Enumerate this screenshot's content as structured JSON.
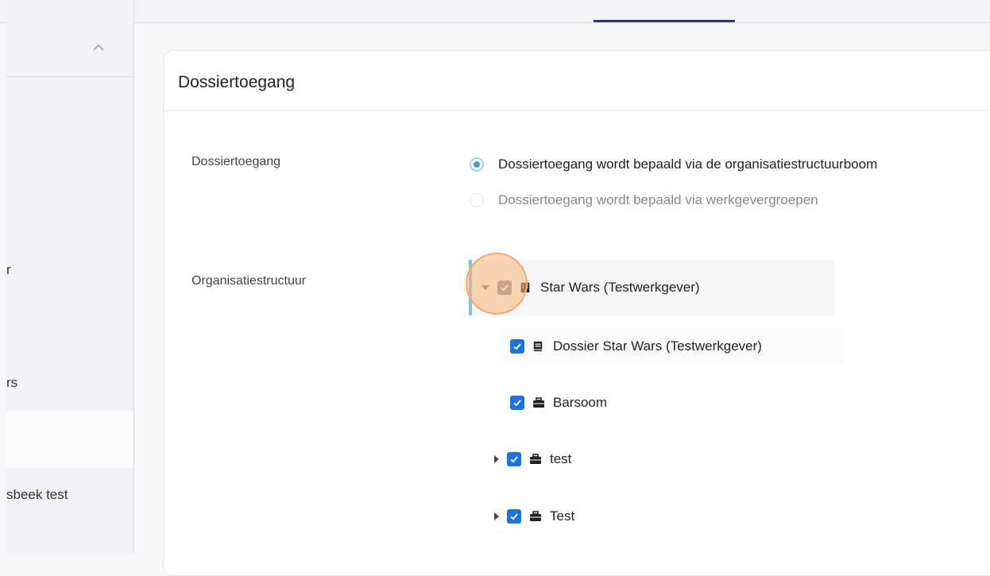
{
  "sidebar": {
    "items": [
      {
        "label": "r"
      },
      {
        "label": "rs"
      },
      {
        "label": ""
      },
      {
        "label": "sbeek test"
      }
    ]
  },
  "card": {
    "title": "Dossiertoegang"
  },
  "access": {
    "label": "Dossiertoegang",
    "options": [
      {
        "label": "Dossiertoegang wordt bepaald via de organisatiestructuurboom",
        "selected": true
      },
      {
        "label": "Dossiertoegang wordt bepaald via werkgevergroepen",
        "selected": false
      }
    ]
  },
  "org": {
    "label": "Organisatiestructuur",
    "nodes": [
      {
        "label": "Star Wars (Testwerkgever)",
        "icon": "building-icon",
        "state": "indeterminate",
        "expanded": true
      },
      {
        "label": "Dossier Star Wars (Testwerkgever)",
        "icon": "book-icon",
        "state": "checked"
      },
      {
        "label": "Barsoom",
        "icon": "briefcase-icon",
        "state": "checked"
      },
      {
        "label": "test",
        "icon": "briefcase-icon",
        "state": "checked",
        "expanded": false
      },
      {
        "label": "Test",
        "icon": "briefcase-icon",
        "state": "checked",
        "expanded": false
      }
    ]
  },
  "colors": {
    "accent": "#1a73e8",
    "radio": "#3aa0dc",
    "highlight": "#f5a86a"
  }
}
